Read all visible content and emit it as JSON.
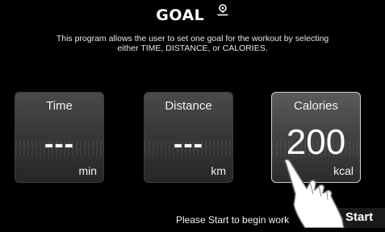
{
  "header": {
    "title": "GOAL",
    "icon": "location-goal-icon",
    "description_line1": "This program allows the user to set one goal for the workout by selecting",
    "description_line2": "either TIME, DISTANCE, or CALORIES."
  },
  "cards": [
    {
      "label": "Time",
      "value": "---",
      "unit": "min",
      "selected": false
    },
    {
      "label": "Distance",
      "value": "---",
      "unit": "km",
      "selected": false
    },
    {
      "label": "Calories",
      "value": "200",
      "unit": "kcal",
      "selected": true
    }
  ],
  "footer": {
    "message": "Please Start to begin work",
    "start_label": "Start"
  },
  "colors": {
    "background": "#000000",
    "card": "#3a3a3a",
    "selected_border": "#cfcfcf",
    "text": "#ffffff"
  }
}
